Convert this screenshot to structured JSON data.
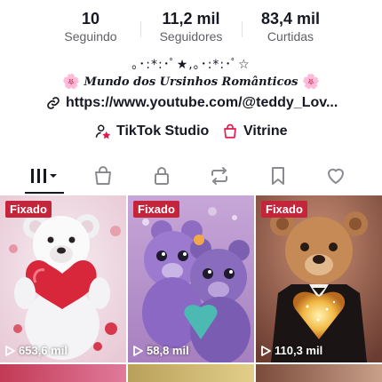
{
  "stats": [
    {
      "value": "10",
      "label": "Seguindo"
    },
    {
      "value": "11,2 mil",
      "label": "Seguidores"
    },
    {
      "value": "83,4 mil",
      "label": "Curtidas"
    }
  ],
  "bio": {
    "line1": "｡･:*:･ﾟ★,｡･:*:･ﾟ☆",
    "flower": "🌸",
    "line2": "Mundo dos Ursinhos Românticos"
  },
  "link": {
    "text": "https://www.youtube.com/@teddy_Lov..."
  },
  "buttons": {
    "studio": "TikTok Studio",
    "vitrine": "Vitrine"
  },
  "tabs": [
    "videos-grid",
    "shop",
    "private",
    "reposts",
    "favorites",
    "liked"
  ],
  "videos": [
    {
      "badge": "Fixado",
      "views": "653,6 mil"
    },
    {
      "badge": "Fixado",
      "views": "58,8 mil"
    },
    {
      "badge": "Fixado",
      "views": "110,3 mil"
    }
  ],
  "colors": {
    "accent": "#c5253a",
    "text": "#161823",
    "muted": "#5f6068"
  }
}
